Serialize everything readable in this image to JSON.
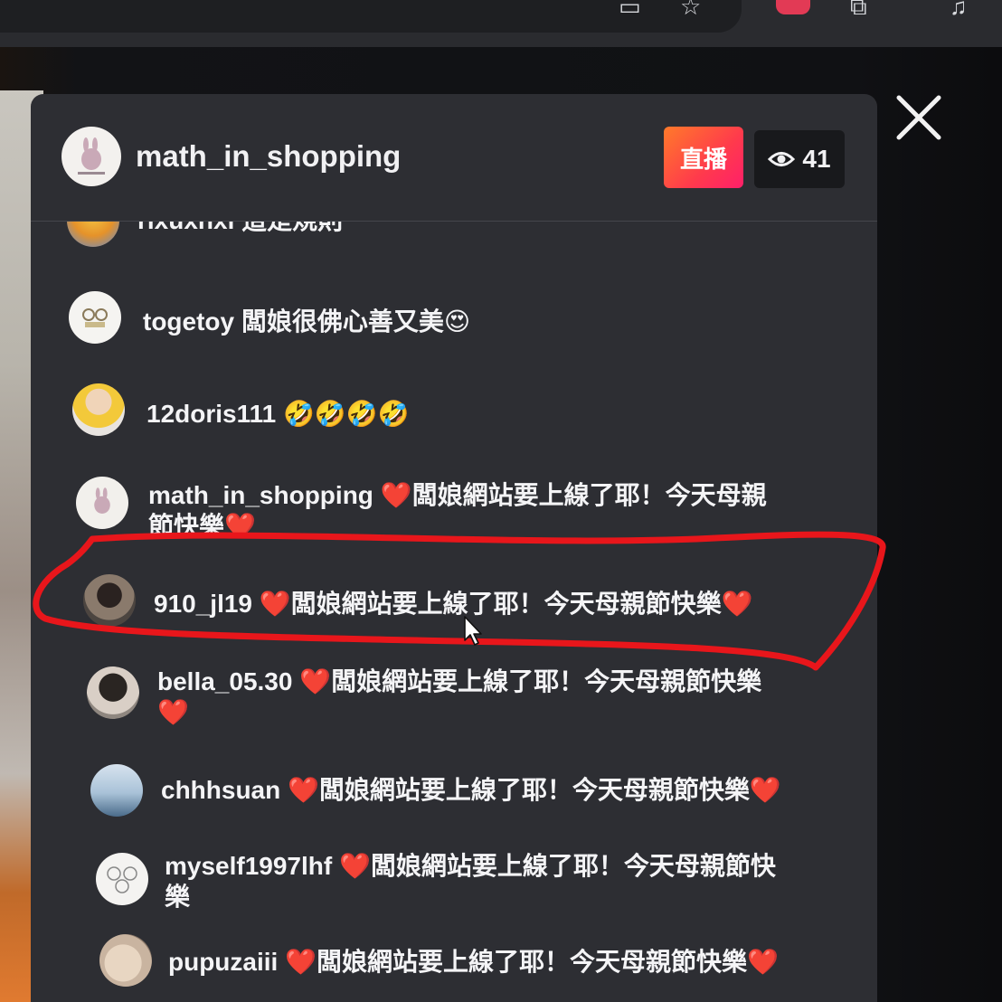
{
  "browser": {
    "url_fragment": "46226422"
  },
  "header": {
    "channel_name": "math_in_shopping",
    "live_label": "直播",
    "viewer_count": "41"
  },
  "messages": [
    {
      "user": "rixuxhxi",
      "text": "這是規則"
    },
    {
      "user": "togetoy",
      "text": "闆娘很佛心善又美😍"
    },
    {
      "user": "12doris111",
      "text": "🤣🤣🤣🤣"
    },
    {
      "user": "math_in_shopping",
      "heart1": "❤️",
      "text": "闆娘網站要上線了耶！今天母親",
      "text2": "節快樂",
      "heart2": "❤️"
    },
    {
      "user": "910_jl19",
      "heart1": "❤️",
      "text": "闆娘網站要上線了耶！今天母親節快樂",
      "heart2": "❤️"
    },
    {
      "user": "bella_05.30",
      "heart1": "❤️",
      "text": "闆娘網站要上線了耶！今天母親節快樂",
      "heart2": "❤️"
    },
    {
      "user": "chhhsuan",
      "heart1": "❤️",
      "text": "闆娘網站要上線了耶！今天母親節快樂",
      "heart2": "❤️"
    },
    {
      "user": "myself1997lhf",
      "heart1": "❤️",
      "text": "闆娘網站要上線了耶！今天母親節快",
      "text2": "樂"
    },
    {
      "user": "pupuzaiii",
      "heart1": "❤️",
      "text": "闆娘網站要上線了耶！今天母親節快樂",
      "heart2": "❤️"
    }
  ],
  "colors": {
    "panel_bg": "#2d2e33",
    "highlight_stroke": "#e8161b",
    "live_gradient_start": "#ff7a2a",
    "live_gradient_end": "#ff1f6a"
  },
  "icons": {
    "viewer": "eye-icon",
    "close": "close-icon",
    "bookmark": "star-icon",
    "display": "monitor-icon"
  }
}
